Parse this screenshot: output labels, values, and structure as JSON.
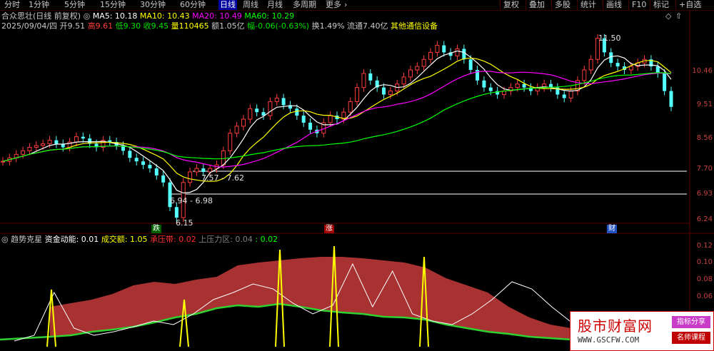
{
  "topbar": {
    "tabs": [
      "分时",
      "1分钟",
      "5分钟",
      "15分钟",
      "30分钟",
      "60分钟",
      "日线",
      "周线",
      "月线",
      "多周期",
      "更多"
    ],
    "active_tab": "日线",
    "right_buttons": [
      "复权",
      "叠加",
      "多股",
      "统计",
      "画线",
      "F10",
      "标记",
      "+自选"
    ]
  },
  "main_info": {
    "title": "合众思壮(日线 前复权)",
    "ma5": "MA5: 10.18",
    "ma10": "MA10: 10.43",
    "ma20": "MA20: 10.49",
    "ma60": "MA60: 10.29"
  },
  "quote_line": {
    "date": "2025/09/04/四",
    "open": "开9.51",
    "high": "高9.61",
    "low": "低9.30",
    "close": "收9.45",
    "volume": "量110465",
    "amount": "额1.05亿",
    "change": "幅-0.06(-0.63%)",
    "turnover": "换1.49%",
    "float": "流通7.40亿",
    "sector": "其他通信设备"
  },
  "price_axis": [
    "10.46",
    "9.51",
    "8.56",
    "7.70",
    "6.93",
    "6.24"
  ],
  "annotations": {
    "high_label": "11.50",
    "low_label": "6.15",
    "range1": "7.57 - 7.62",
    "range2": "6.94 - 6.98"
  },
  "badges": {
    "fall": "跌",
    "rise": "涨",
    "finance": "财"
  },
  "indicator": {
    "name": "趋势克星",
    "fund_energy": "资金动能: 0.01",
    "volume_amount": "成交额: 1.05",
    "support": "承压带: 0.02",
    "pressure_zone": "上压力区: 0.04",
    "extra": ": 0.02",
    "axis": [
      "0.12",
      "0.10",
      "0.08",
      "0.06"
    ]
  },
  "watermark": {
    "title": "股市财富网",
    "url": "WWW.GSCFW.COM",
    "tag1": "指标分享",
    "tag2": "名师课程"
  },
  "colors": {
    "up": "#ff3c3c",
    "down": "#54ffff",
    "ma5": "#ffffff",
    "ma10": "#ffff00",
    "ma20": "#ff00ff",
    "ma60": "#00ff00",
    "band": "#a83232"
  }
}
